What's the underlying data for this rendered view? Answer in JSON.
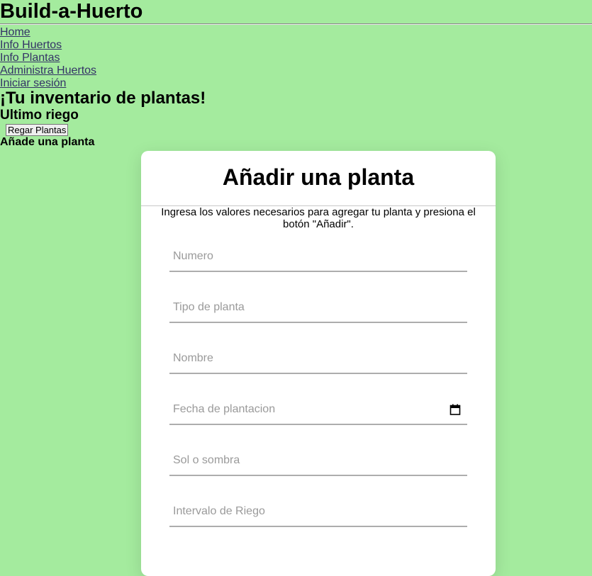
{
  "site": {
    "title": "Build-a-Huerto"
  },
  "nav": {
    "items": [
      {
        "label": "Home"
      },
      {
        "label": "Info Huertos"
      },
      {
        "label": "Info Plantas"
      },
      {
        "label": "Administra Huertos"
      },
      {
        "label": "Iniciar sesión"
      }
    ]
  },
  "inventory": {
    "heading": "¡Tu inventario de plantas!",
    "last_watering_heading": "Ultimo riego",
    "water_button_label": "Regar Plantas",
    "add_plant_heading": "Añade una planta"
  },
  "form": {
    "title": "Añadir una planta",
    "description": "Ingresa los valores necesarios para agregar tu planta y presiona el botón \"Añadir\".",
    "fields": [
      {
        "placeholder": "Numero"
      },
      {
        "placeholder": "Tipo de planta"
      },
      {
        "placeholder": "Nombre"
      },
      {
        "placeholder": "Fecha de plantacion",
        "icon": "calendar-icon"
      },
      {
        "placeholder": "Sol o sombra"
      },
      {
        "placeholder": "Intervalo de Riego"
      }
    ]
  },
  "colors": {
    "page_background": "#a4eb9e",
    "card_background": "#ffffff",
    "link": "#333366",
    "placeholder": "#9a9a9a",
    "underline": "#adadad"
  }
}
